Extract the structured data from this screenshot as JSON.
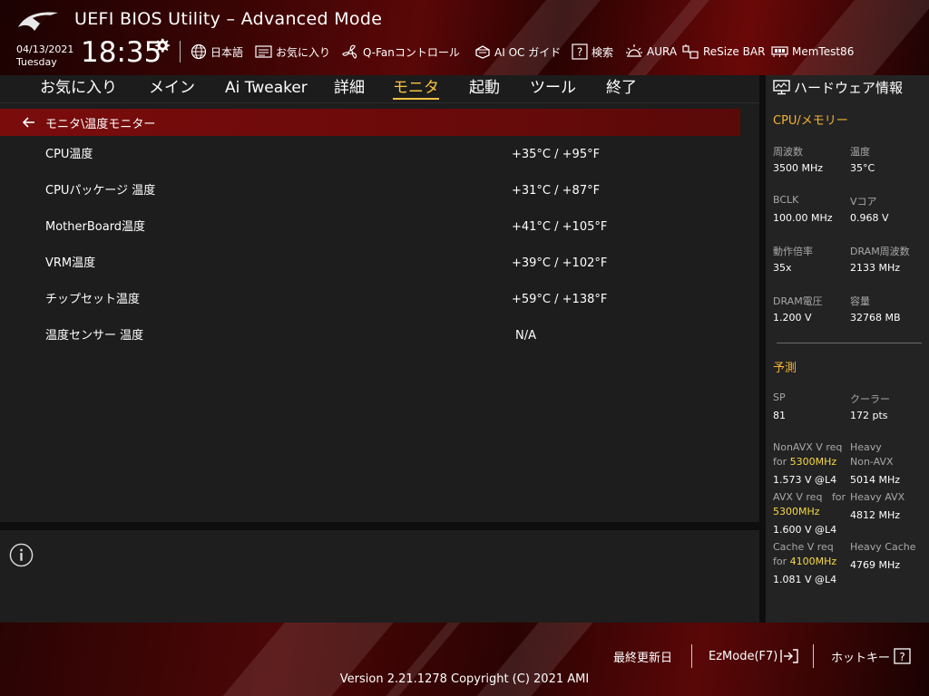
{
  "header": {
    "title": "UEFI BIOS Utility – Advanced Mode",
    "date": "04/13/2021",
    "weekday": "Tuesday",
    "time": "18:35",
    "toolbar": [
      {
        "name": "language-button",
        "icon": "globe-icon",
        "label": "日本語"
      },
      {
        "name": "favorites-button",
        "icon": "favorites-icon",
        "label": "お気に入り"
      },
      {
        "name": "qfan-control-button",
        "icon": "fan-icon",
        "label": "Q-Fanコントロール"
      },
      {
        "name": "ai-oc-guide-button",
        "icon": "oc-guide-icon",
        "label": "AI OC ガイド"
      },
      {
        "name": "search-button",
        "icon": "help-search-icon",
        "label": "検索"
      },
      {
        "name": "aura-button",
        "icon": "aura-icon",
        "label": "AURA"
      },
      {
        "name": "resize-bar-button",
        "icon": "resize-bar-icon",
        "label": "ReSize BAR"
      },
      {
        "name": "memtest-button",
        "icon": "memory-icon",
        "label": "MemTest86"
      }
    ]
  },
  "tabs": [
    {
      "label": "お気に入り",
      "active": false
    },
    {
      "label": "メイン",
      "active": false
    },
    {
      "label": "Ai Tweaker",
      "active": false
    },
    {
      "label": "詳細",
      "active": false
    },
    {
      "label": "モニタ",
      "active": true
    },
    {
      "label": "起動",
      "active": false
    },
    {
      "label": "ツール",
      "active": false
    },
    {
      "label": "終了",
      "active": false
    }
  ],
  "breadcrumb": "モニタ\\温度モニター",
  "rows": [
    {
      "label": "CPU温度",
      "value": "+35°C / +95°F"
    },
    {
      "label": "CPUパッケージ 温度",
      "value": "+31°C / +87°F"
    },
    {
      "label": "MotherBoard温度",
      "value": "+41°C / +105°F"
    },
    {
      "label": "VRM温度",
      "value": "+39°C / +102°F"
    },
    {
      "label": "チップセット温度",
      "value": "+59°C / +138°F"
    },
    {
      "label": "温度センサー 温度",
      "value": "N/A"
    }
  ],
  "hw": {
    "title": "ハードウェア情報",
    "cpu_section": "CPU/メモリー",
    "cpu": [
      {
        "l1": "周波数",
        "v1": "3500 MHz",
        "l2": "温度",
        "v2": "35°C"
      },
      {
        "l1": "BCLK",
        "v1": "100.00 MHz",
        "l2": "Vコア",
        "v2": "0.968 V"
      },
      {
        "l1": "動作倍率",
        "v1": "35x",
        "l2": "DRAM周波数",
        "v2": "2133 MHz"
      },
      {
        "l1": "DRAM電圧",
        "v1": "1.200 V",
        "l2": "容量",
        "v2": "32768 MB"
      }
    ],
    "pred_section": "予測",
    "sp_label": "SP",
    "sp_value": "81",
    "cooler_label": "クーラー",
    "cooler_value": "172 pts",
    "nonavx_label_a": "NonAVX V req",
    "nonavx_label_b": "for",
    "nonavx_freq": "5300MHz",
    "nonavx_value": "1.573 V @L4",
    "heavy_nonavx_label_a": "Heavy",
    "heavy_nonavx_label_b": "Non-AVX",
    "heavy_nonavx_value": "5014 MHz",
    "avx_label_a": "AVX V req",
    "avx_label_b": "for",
    "avx_freq": "5300MHz",
    "avx_value": "1.600 V @L4",
    "heavy_avx_label": "Heavy AVX",
    "heavy_avx_value": "4812 MHz",
    "cache_label_a": "Cache V req",
    "cache_label_b": "for",
    "cache_freq": "4100MHz",
    "cache_value": "1.081 V @L4",
    "heavy_cache_label": "Heavy Cache",
    "heavy_cache_value": "4769 MHz"
  },
  "footer": {
    "last_modified": "最終更新日",
    "ezmode": "EzMode(F7)",
    "hotkeys": "ホットキー",
    "version": "Version 2.21.1278 Copyright (C) 2021 AMI"
  },
  "colors": {
    "accent": "#f6c343",
    "breadcrumb_bg": "#7a0c0c",
    "highlight_freq": "#f6d847"
  }
}
